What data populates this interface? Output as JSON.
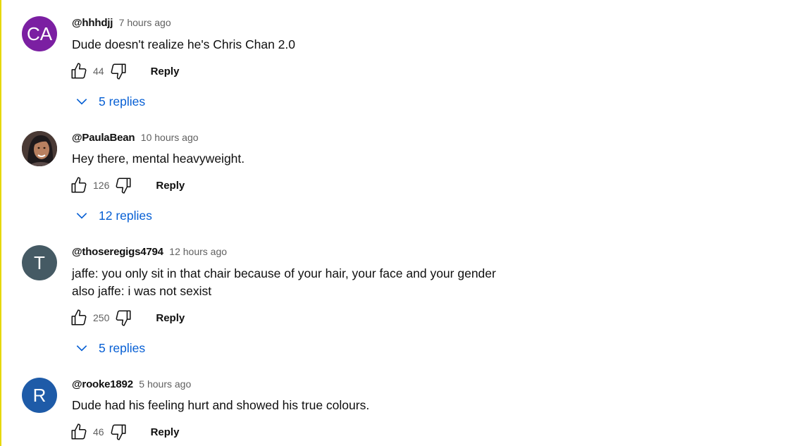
{
  "comments": [
    {
      "avatar_initials": "CA",
      "avatar_color": "#7b1fa2",
      "author": "@hhhdjj",
      "time": "7 hours ago",
      "lines": [
        "Dude doesn't realize he's Chris Chan 2.0"
      ],
      "likes": "44",
      "reply_label": "Reply",
      "replies_label": "5 replies"
    },
    {
      "avatar_initials": "",
      "avatar_color": "#3a2a26",
      "author": "@PaulaBean",
      "time": "10 hours ago",
      "lines": [
        "Hey there, mental heavyweight."
      ],
      "likes": "126",
      "reply_label": "Reply",
      "replies_label": "12 replies"
    },
    {
      "avatar_initials": "T",
      "avatar_color": "#455a64",
      "author": "@thoseregigs4794",
      "time": "12 hours ago",
      "lines": [
        "jaffe: you only sit in that chair because of your hair, your face and your gender",
        "also jaffe: i was not sexist"
      ],
      "likes": "250",
      "reply_label": "Reply",
      "replies_label": "5 replies"
    },
    {
      "avatar_initials": "R",
      "avatar_color": "#1e5ba8",
      "author": "@rooke1892",
      "time": "5 hours ago",
      "lines": [
        "Dude had his feeling hurt and showed his true colours."
      ],
      "likes": "46",
      "reply_label": "Reply"
    }
  ],
  "icons": {
    "like": "thumb-up-icon",
    "dislike": "thumb-down-icon",
    "expand": "chevron-down-icon"
  },
  "colors": {
    "link_blue": "#065fd4",
    "secondary_text": "#606060"
  }
}
